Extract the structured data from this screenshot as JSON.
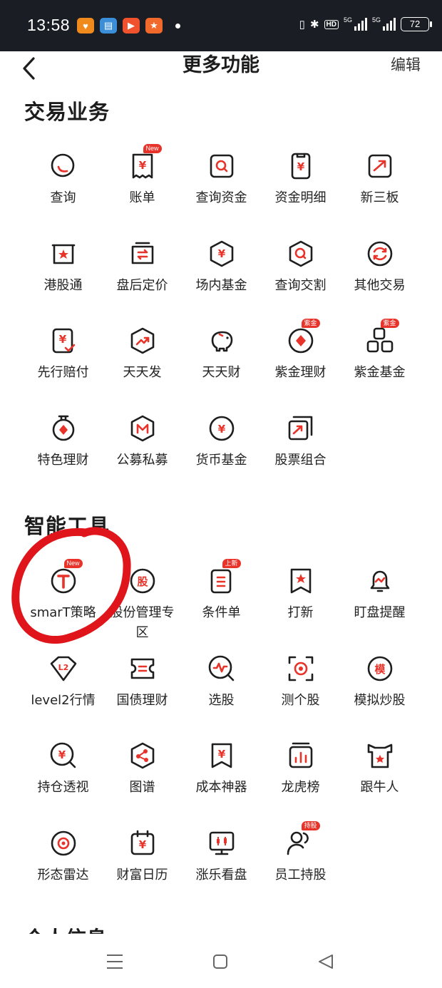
{
  "status_bar": {
    "time": "13:58",
    "network_1": "5G",
    "network_2": "5G",
    "hd_label": "HD",
    "battery": "72",
    "apps": [
      {
        "icon": "app-heart-icon",
        "color": "#f08a1c",
        "glyph": "♥"
      },
      {
        "icon": "wallet-icon",
        "color": "#3a8fd8",
        "glyph": "▤"
      },
      {
        "icon": "video-play-icon",
        "color": "#f0522d",
        "glyph": "▶"
      },
      {
        "icon": "sport-app-icon",
        "color": "#f26a2b",
        "glyph": "★"
      }
    ]
  },
  "header": {
    "title": "更多功能",
    "edit": "编辑"
  },
  "sections": [
    {
      "title": "交易业务",
      "items": [
        {
          "label": "查询",
          "icon": "search-query-icon"
        },
        {
          "label": "账单",
          "icon": "bill-icon",
          "badge": "New"
        },
        {
          "label": "查询资金",
          "icon": "fund-search-icon"
        },
        {
          "label": "资金明细",
          "icon": "fund-detail-icon"
        },
        {
          "label": "新三板",
          "icon": "new-third-board-icon"
        },
        {
          "label": "港股通",
          "icon": "hk-connect-icon"
        },
        {
          "label": "盘后定价",
          "icon": "after-hours-pricing-icon"
        },
        {
          "label": "场内基金",
          "icon": "exchange-fund-icon"
        },
        {
          "label": "查询交割",
          "icon": "settlement-query-icon"
        },
        {
          "label": "其他交易",
          "icon": "other-trade-icon"
        },
        {
          "label": "先行赔付",
          "icon": "advance-compensation-icon"
        },
        {
          "label": "天天发",
          "icon": "daily-growth-icon"
        },
        {
          "label": "天天财",
          "icon": "piggy-bank-icon"
        },
        {
          "label": "紫金理财",
          "icon": "zijin-wealth-icon",
          "badge": "紫金"
        },
        {
          "label": "紫金基金",
          "icon": "zijin-fund-icon",
          "badge": "紫金"
        },
        {
          "label": "特色理财",
          "icon": "featured-wealth-icon"
        },
        {
          "label": "公募私募",
          "icon": "public-private-fund-icon"
        },
        {
          "label": "货币基金",
          "icon": "money-fund-icon"
        },
        {
          "label": "股票组合",
          "icon": "stock-portfolio-icon"
        }
      ]
    },
    {
      "title": "智能工具",
      "items": [
        {
          "label": "smarT策略",
          "icon": "smart-t-strategy-icon",
          "badge": "New"
        },
        {
          "label": "股份管理专区",
          "icon": "share-management-icon"
        },
        {
          "label": "条件单",
          "icon": "conditional-order-icon",
          "badge": "上新"
        },
        {
          "label": "打新",
          "icon": "ipo-subscribe-icon"
        },
        {
          "label": "盯盘提醒",
          "icon": "market-alert-bell-icon"
        },
        {
          "label": "level2行情",
          "icon": "level2-quotes-icon"
        },
        {
          "label": "国债理财",
          "icon": "treasury-bond-icon"
        },
        {
          "label": "选股",
          "icon": "stock-screener-icon"
        },
        {
          "label": "测个股",
          "icon": "stock-diagnosis-icon"
        },
        {
          "label": "模拟炒股",
          "icon": "simulated-trading-icon"
        },
        {
          "label": "持仓透视",
          "icon": "position-insight-icon"
        },
        {
          "label": "图谱",
          "icon": "knowledge-graph-icon"
        },
        {
          "label": "成本神器",
          "icon": "cost-tool-icon"
        },
        {
          "label": "龙虎榜",
          "icon": "dragon-tiger-list-icon"
        },
        {
          "label": "跟牛人",
          "icon": "follow-experts-icon"
        },
        {
          "label": "形态雷达",
          "icon": "pattern-radar-icon"
        },
        {
          "label": "财富日历",
          "icon": "wealth-calendar-icon"
        },
        {
          "label": "涨乐看盘",
          "icon": "market-watch-icon"
        },
        {
          "label": "员工持股",
          "icon": "employee-holdings-icon",
          "badge": "持股"
        }
      ]
    }
  ],
  "next_section_title": "个人信息",
  "colors": {
    "accent": "#e8332a",
    "icon_stroke": "#1e1e1e",
    "annotation": "#e0141b"
  },
  "nav": {
    "menu": "menu-icon",
    "home": "home-square-icon",
    "back": "back-triangle-icon"
  }
}
